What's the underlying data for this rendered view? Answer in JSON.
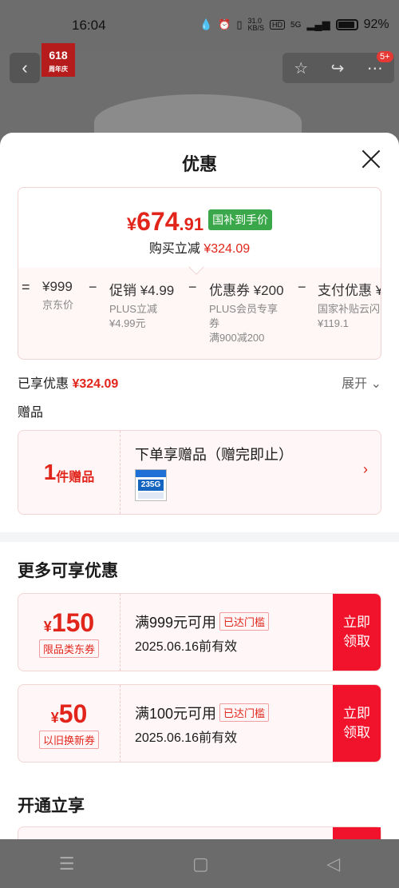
{
  "status_bar": {
    "time": "16:04",
    "network_speed": "31.0\nKB/S",
    "hd": "HD",
    "signal": "5G",
    "battery": "92%"
  },
  "background": {
    "logo_main": "618",
    "logo_sub": "周年庆",
    "badge": "5+"
  },
  "sheet": {
    "title": "优惠"
  },
  "price": {
    "yen": "¥",
    "int": "674",
    "dec": ".91",
    "tag": "国补到手价",
    "reduce_label": "购买立减",
    "reduce_value": "¥324.09"
  },
  "breakdown": [
    {
      "op": "=",
      "head": "¥999",
      "sub": "京东价"
    },
    {
      "op": "−",
      "head": "促销 ¥4.99",
      "sub": "PLUS立减\n¥4.99元"
    },
    {
      "op": "−",
      "head": "优惠券 ¥200",
      "sub": "PLUS会员专享券\n满900减200"
    },
    {
      "op": "−",
      "head": "支付优惠 ¥",
      "sub": "国家补贴云闪\n¥119.1"
    }
  ],
  "enjoyed": {
    "label": "已享优惠",
    "value": "¥324.09",
    "expand": "展开"
  },
  "gift": {
    "section_label": "赠品",
    "count": "1",
    "count_unit": "件赠品",
    "title": "下单享赠品（赠完即止）",
    "image_text": "235G"
  },
  "more": {
    "title": "更多可享优惠"
  },
  "coupons": [
    {
      "yen": "¥",
      "amount": "150",
      "type": "限品类东券",
      "cond": "满999元可用",
      "reach": "已达门槛",
      "valid": "2025.06.16前有效",
      "claim": "立即\n领取"
    },
    {
      "yen": "¥",
      "amount": "50",
      "type": "以旧换新券",
      "cond": "满100元可用",
      "reach": "已达门槛",
      "valid": "2025.06.16前有效",
      "claim": "立即\n领取"
    }
  ],
  "open": {
    "title": "开通立享"
  },
  "icons": {
    "back": "chevron-left-icon",
    "star": "star-icon",
    "share": "share-icon",
    "more": "more-dots-icon",
    "close": "close-icon"
  },
  "colors": {
    "accent_red": "#e1251b",
    "claim_red": "#f0132b",
    "green_tag": "#3aa84a"
  }
}
